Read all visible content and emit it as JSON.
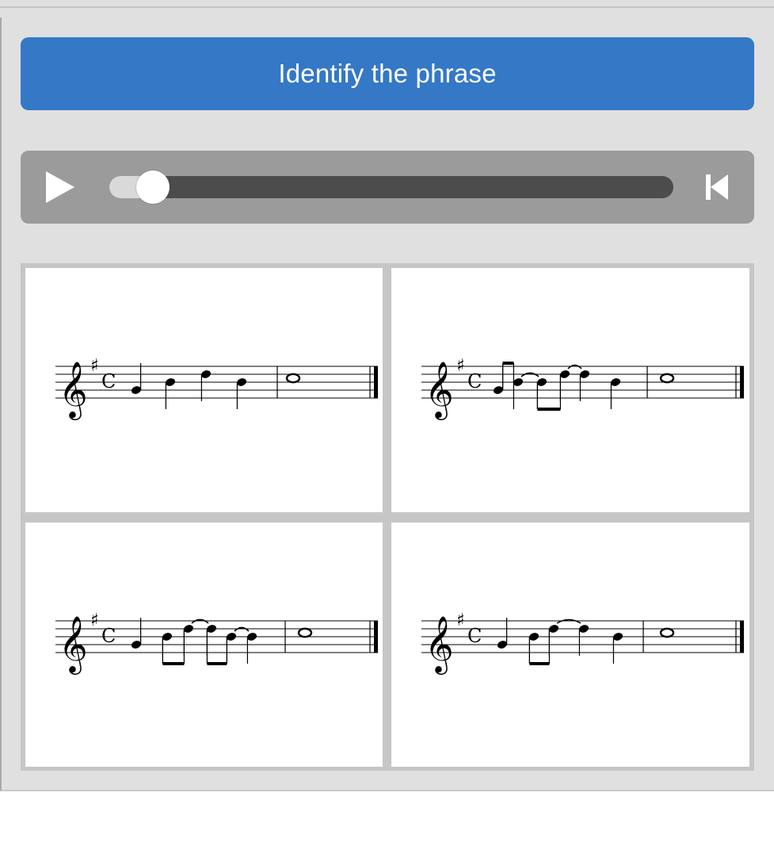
{
  "header": {
    "title": "Identify the phrase"
  },
  "player": {
    "play_icon": "play-icon",
    "restart_icon": "skip-to-start-icon",
    "progress": 0.06
  },
  "options": [
    {
      "id": "option-1",
      "key_signature": "G major (1 sharp)",
      "time_signature": "C",
      "notes": [
        {
          "pitch": "G4",
          "duration": "quarter"
        },
        {
          "pitch": "B4",
          "duration": "quarter"
        },
        {
          "pitch": "D5",
          "duration": "quarter"
        },
        {
          "pitch": "B4",
          "duration": "quarter"
        },
        {
          "pitch": "C5",
          "duration": "whole"
        }
      ]
    },
    {
      "id": "option-2",
      "key_signature": "G major (1 sharp)",
      "time_signature": "C",
      "notes": [
        {
          "pitch": "G4",
          "duration": "eighth"
        },
        {
          "pitch": "B4",
          "duration": "eighth",
          "tie": true
        },
        {
          "pitch": "B4",
          "duration": "eighth"
        },
        {
          "pitch": "D5",
          "duration": "eighth",
          "tie": true
        },
        {
          "pitch": "D5",
          "duration": "quarter"
        },
        {
          "pitch": "B4",
          "duration": "quarter"
        },
        {
          "pitch": "C5",
          "duration": "whole"
        }
      ]
    },
    {
      "id": "option-3",
      "key_signature": "G major (1 sharp)",
      "time_signature": "C",
      "notes": [
        {
          "pitch": "G4",
          "duration": "quarter"
        },
        {
          "pitch": "B4",
          "duration": "eighth"
        },
        {
          "pitch": "D5",
          "duration": "eighth",
          "tie": true
        },
        {
          "pitch": "D5",
          "duration": "eighth"
        },
        {
          "pitch": "B4",
          "duration": "eighth",
          "tie": true
        },
        {
          "pitch": "B4",
          "duration": "quarter"
        },
        {
          "pitch": "C5",
          "duration": "whole"
        }
      ]
    },
    {
      "id": "option-4",
      "key_signature": "G major (1 sharp)",
      "time_signature": "C",
      "notes": [
        {
          "pitch": "G4",
          "duration": "quarter"
        },
        {
          "pitch": "B4",
          "duration": "eighth"
        },
        {
          "pitch": "D5",
          "duration": "eighth",
          "tie": true
        },
        {
          "pitch": "D5",
          "duration": "quarter"
        },
        {
          "pitch": "B4",
          "duration": "quarter"
        },
        {
          "pitch": "C5",
          "duration": "whole"
        }
      ]
    }
  ]
}
